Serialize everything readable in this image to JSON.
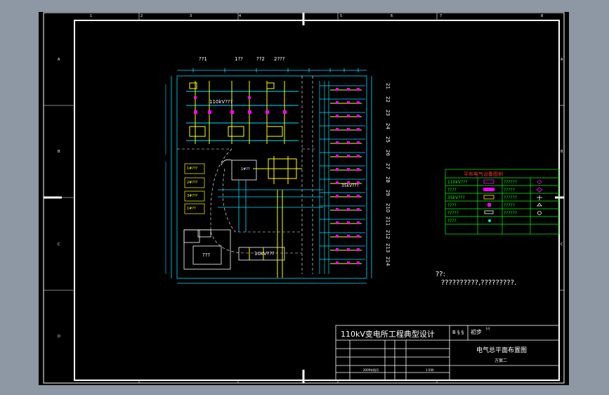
{
  "colors": {
    "background": "#8d98a4",
    "canvas": "#000000",
    "frame_line": "#ffffff",
    "bus_cyan": "#00e0ff",
    "equip_yellow": "#ffff00",
    "equip_magenta": "#ff00ff",
    "legend_green": "#00ff00",
    "legend_title_red": "#ff3030",
    "note_text": "#ffffff"
  },
  "border": {
    "top_numbers": [
      "1",
      "2",
      "3",
      "4",
      "5",
      "6",
      "7",
      "8"
    ],
    "side_letters": [
      "A",
      "B",
      "C",
      "D"
    ]
  },
  "plan": {
    "top_labels": [
      "??1",
      "1??",
      "??2",
      "2???"
    ],
    "room_labels": {
      "hv_yard": "110kV???",
      "mv_yard": "35kV???",
      "lv_yard": "10kV???",
      "main_building": "???",
      "transformer": "1#??"
    },
    "left_boxes": [
      "1#???",
      "2#???",
      "3#???",
      "1#??"
    ],
    "bay_numbers": [
      "21",
      "22",
      "23",
      "24",
      "25",
      "26",
      "27",
      "28",
      "29",
      "210",
      "211",
      "212",
      "213",
      "214"
    ]
  },
  "legend": {
    "title": "平布电气设备图例",
    "rows": [
      {
        "left": "110kV???",
        "right": "??????"
      },
      {
        "left": "????",
        "right": "?????"
      },
      {
        "left": "35kV???",
        "right": "??????"
      },
      {
        "left": "????",
        "right": "?????"
      },
      {
        "left": "?????",
        "right": "??????"
      },
      {
        "left": "????",
        "right": ""
      }
    ]
  },
  "notes": {
    "label": "??:",
    "text": "??????????,?????????."
  },
  "title_block": {
    "project": "110kV变电所工程典型设计",
    "grade_letters": "B § §",
    "stage": "初步",
    "stage_sub": "§ §",
    "drawing_title": "电气总平面布置图",
    "scheme": "方案二",
    "date": "2009年§§月",
    "scale": "1:500"
  }
}
